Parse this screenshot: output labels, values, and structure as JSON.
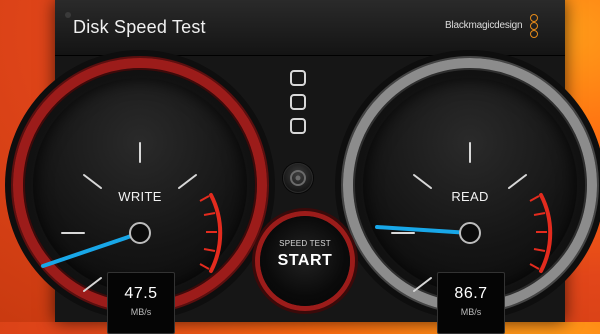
{
  "window": {
    "title": "Disk Speed Test",
    "brand": "Blackmagicdesign"
  },
  "gauges": {
    "write": {
      "label": "WRITE",
      "value": "47.5",
      "unit": "MB/s",
      "needle_angle_deg": -158
    },
    "read": {
      "label": "READ",
      "value": "86.7",
      "unit": "MB/s",
      "needle_angle_deg": 174
    }
  },
  "center": {
    "start_small": "SPEED TEST",
    "start_big": "START"
  },
  "colors": {
    "needle": "#18a7e8",
    "redline": "#e32b1e",
    "write_ring": "#9c1c1a",
    "read_ring": "#8c8c8c",
    "brand_accent": "#e58a19"
  },
  "icons": {
    "brand_mark": "blackmagic-logo-icon",
    "settings": "gear-icon",
    "target_selectors": "square-icons"
  }
}
